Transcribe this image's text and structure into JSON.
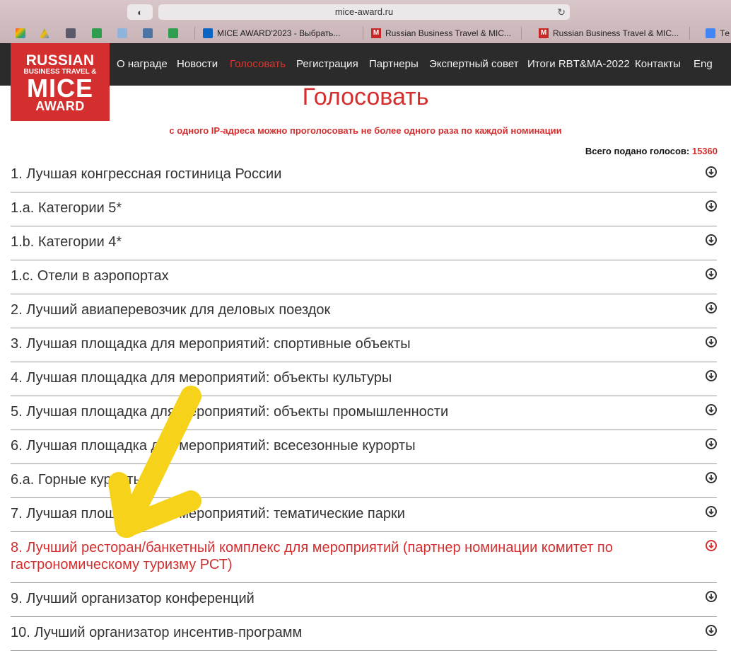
{
  "browser": {
    "url": "mice-award.ru",
    "tabs": [
      {
        "label": "MICE AWARD'2023 - Выбрать..."
      },
      {
        "label": "Russian Business Travel & MIC..."
      },
      {
        "label": "Russian Business Travel & MIC..."
      },
      {
        "label": "Tе"
      }
    ]
  },
  "logo": {
    "line1": "RUSSIAN",
    "line2": "BUSINESS TRAVEL &",
    "line3": "MICE",
    "line4": "AWARD"
  },
  "nav": {
    "items": [
      {
        "label": "О награде"
      },
      {
        "label": "Новости"
      },
      {
        "label": "Голосовать"
      },
      {
        "label": "Регистрация"
      },
      {
        "label": "Партнеры"
      },
      {
        "label": "Экспертный совет"
      },
      {
        "label": "Итоги RBT&MA-2022"
      },
      {
        "label": "Контакты"
      },
      {
        "label": "Eng"
      }
    ]
  },
  "page": {
    "title": "Голосовать",
    "notice": "с одного IP-адреса можно проголосовать не более одного раза по каждой номинации",
    "total_label": "Всего подано голосов:",
    "total_value": "15360"
  },
  "nominations": [
    {
      "label": "1. Лучшая конгрессная гостиница России"
    },
    {
      "label": "1.a. Категории 5*"
    },
    {
      "label": "1.b. Категории 4*"
    },
    {
      "label": "1.c. Отели в аэропортах"
    },
    {
      "label": "2. Лучший авиаперевозчик для деловых поездок"
    },
    {
      "label": "3. Лучшая площадка для мероприятий: спортивные объекты"
    },
    {
      "label": "4. Лучшая площадка для мероприятий: объекты культуры"
    },
    {
      "label": "5. Лучшая площадка для мероприятий: объекты промышленности"
    },
    {
      "label": "6. Лучшая площадка для мероприятий: всесезонные курорты"
    },
    {
      "label": "6.a. Горные курорты"
    },
    {
      "label": "7. Лучшая площадка для мероприятий: тематические парки"
    },
    {
      "label": "8. Лучший ресторан/банкетный комплекс для мероприятий (партнер номинации комитет по гастрономическому туризму РСТ)"
    },
    {
      "label": "9. Лучший организатор конференций"
    },
    {
      "label": "10. Лучший организатор инсентив-программ"
    }
  ],
  "colors": {
    "accent": "#d32f2f",
    "nav_bg": "#2b2b2b",
    "annotation_arrow": "#f7d21b"
  }
}
